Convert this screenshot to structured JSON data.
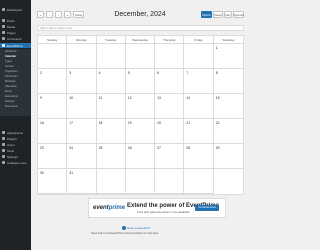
{
  "sidebar": {
    "items": [
      {
        "label": "Dashboard"
      },
      {
        "label": "Posts"
      },
      {
        "label": "Media"
      },
      {
        "label": "Pages"
      },
      {
        "label": "Comments"
      },
      {
        "label": "EventPrime"
      },
      {
        "label": "Appearance"
      },
      {
        "label": "Plugins"
      },
      {
        "label": "Users"
      },
      {
        "label": "Tools"
      },
      {
        "label": "Settings"
      },
      {
        "label": "Collapse menu"
      }
    ],
    "sub_items": [
      {
        "label": "All Events"
      },
      {
        "label": "Calendar"
      },
      {
        "label": "Types"
      },
      {
        "label": "Venues"
      },
      {
        "label": "Organizers"
      },
      {
        "label": "Performers"
      },
      {
        "label": "Bookings"
      },
      {
        "label": "Attendees"
      },
      {
        "label": "Email"
      },
      {
        "label": "Extensions"
      },
      {
        "label": "Settings"
      },
      {
        "label": "Extensions"
      }
    ]
  },
  "toolbar": {
    "nav_prev_prev": "«",
    "nav_prev": "‹",
    "nav_next": "›",
    "nav_next_next": "»",
    "today_label": "Today",
    "title": "December, 2024",
    "month_label": "Month",
    "week_label": "Week",
    "day_label": "Day",
    "list_label": "Agenda"
  },
  "search": {
    "placeholder": "Click to add or search event"
  },
  "calendar": {
    "weekdays": [
      "Sunday",
      "Monday",
      "Tuesday",
      "Wednesday",
      "Thursday",
      "Friday",
      "Saturday"
    ],
    "days": [
      "",
      "",
      "",
      "",
      "",
      "",
      "1",
      "2",
      "3",
      "4",
      "5",
      "6",
      "7",
      "8",
      "9",
      "10",
      "11",
      "12",
      "13",
      "14",
      "15",
      "16",
      "17",
      "18",
      "19",
      "20",
      "21",
      "22",
      "23",
      "24",
      "25",
      "26",
      "27",
      "28",
      "29",
      "30",
      "31",
      "",
      "",
      "",
      ""
    ]
  },
  "banner": {
    "logo_prefix": "event",
    "logo_suffix": "prime",
    "title": "Extend the power of EventPrime",
    "subtitle": "Free and paid extensions now available",
    "button": "Get Extensions"
  },
  "footer": {
    "question": "Have a question?",
    "text": "Need help to find EventPrime Documentation for help here"
  }
}
